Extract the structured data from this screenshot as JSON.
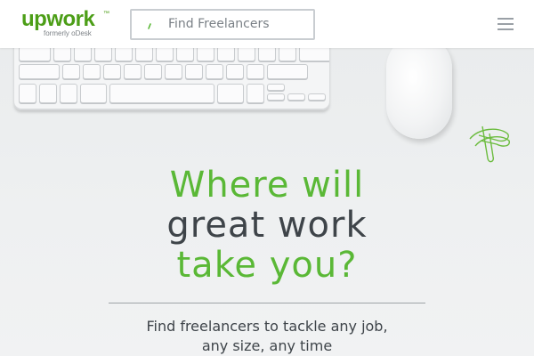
{
  "brand": {
    "name": "upwork",
    "tagline": "formerly oDesk",
    "trademark": "™",
    "color": "#4c9e17"
  },
  "search": {
    "placeholder": "Find Freelancers",
    "icon": "search-icon"
  },
  "menu": {
    "icon": "hamburger-menu-icon"
  },
  "hero": {
    "line1": "Where will",
    "line2": "great work",
    "line3": "take you?",
    "subline1": "Find freelancers to tackle any job,",
    "subline2": "any size, any time",
    "accent_color": "#5ab836",
    "text_color": "#3e4449"
  }
}
